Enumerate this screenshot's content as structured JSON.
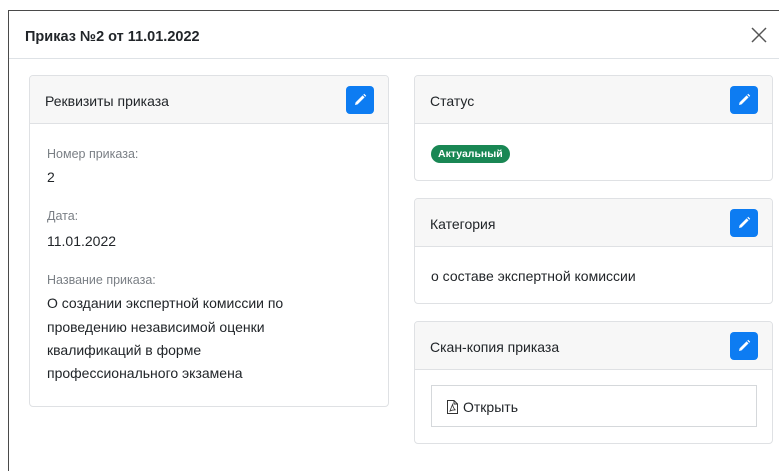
{
  "modal": {
    "title": "Приказ №2 от 11.01.2022"
  },
  "details_card": {
    "title": "Реквизиты приказа",
    "fields": [
      {
        "label": "Номер приказа:",
        "value": "2"
      },
      {
        "label": "Дата:",
        "value": "11.01.2022"
      },
      {
        "label": "Название приказа:",
        "value_lines": [
          "О создании экспертной комиссии по",
          "проведению независимой оценки",
          "квалификаций в форме",
          "профессионального экзамена"
        ]
      }
    ]
  },
  "status_card": {
    "title": "Статус",
    "badge": "Актуальный"
  },
  "category_card": {
    "title": "Категория",
    "value": "о составе экспертной комиссии"
  },
  "scan_card": {
    "title": "Скан-копия приказа",
    "open_label": "Открыть"
  },
  "colors": {
    "accent": "#0d7cf2",
    "badge_green": "#198754",
    "header_bg": "#f7f7f7"
  }
}
